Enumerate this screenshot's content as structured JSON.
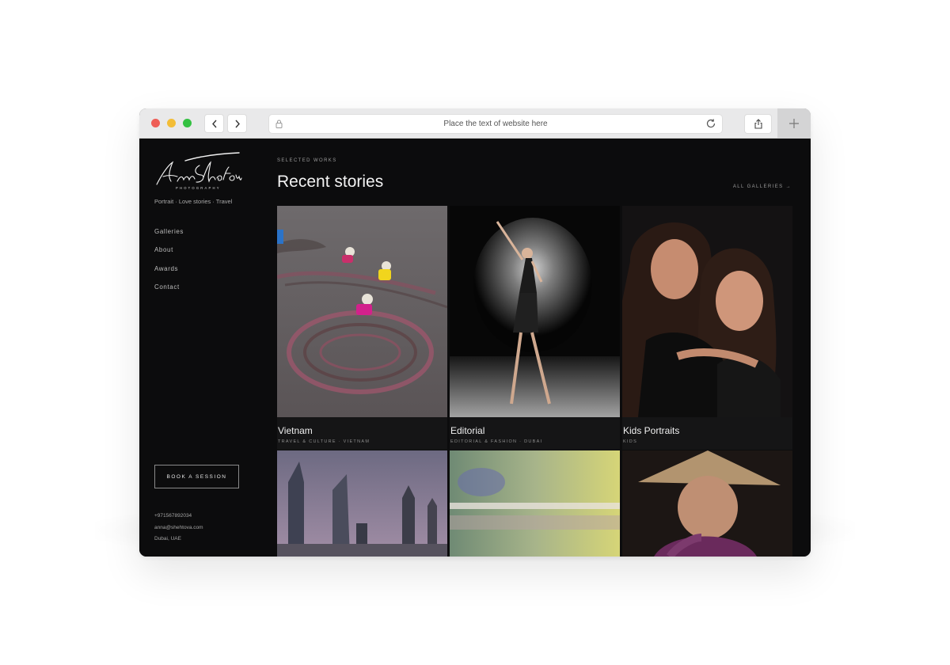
{
  "browser": {
    "url_text": "Place the text of website here"
  },
  "sidebar": {
    "logo_text": "Anna Shehtova",
    "logo_subtext": "PHOTOGRAPHY",
    "tagline": "Portrait · Love stories · Travel",
    "nav": [
      "Galleries",
      "About",
      "Awards",
      "Contact"
    ],
    "book_button": "BOOK A SESSION",
    "contact": {
      "phone": "+971567892034",
      "email": "anna@shehtova.com",
      "location": "Dubai, UAE"
    }
  },
  "main": {
    "eyebrow": "SELECTED WORKS",
    "heading": "Recent stories",
    "all_galleries": "ALL GALLERIES →",
    "cards": [
      {
        "title": "Vietnam",
        "subtitle": "TRAVEL & CULTURE · VIETNAM"
      },
      {
        "title": "Editorial",
        "subtitle": "EDITORIAL & FASHION · DUBAI"
      },
      {
        "title": "Kids Portraits",
        "subtitle": "KIDS"
      }
    ]
  },
  "colors": {
    "page_bg": "#0c0c0d",
    "chrome_bg": "#e9e9ea",
    "close": "#ee5d56",
    "minimize": "#f3bd37",
    "maximize": "#34c142"
  }
}
